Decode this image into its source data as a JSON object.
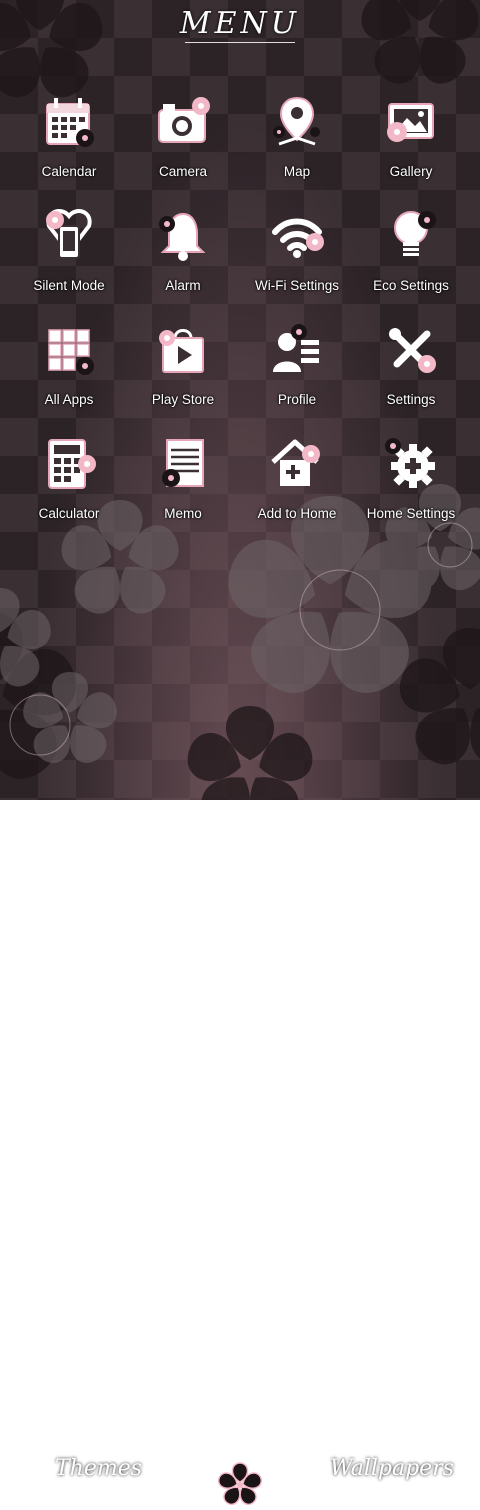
{
  "header": {
    "title": "MENU"
  },
  "apps": [
    {
      "label": "Calendar",
      "icon": "calendar-icon"
    },
    {
      "label": "Camera",
      "icon": "camera-icon"
    },
    {
      "label": "Map",
      "icon": "map-pin-icon"
    },
    {
      "label": "Gallery",
      "icon": "gallery-icon"
    },
    {
      "label": "Silent Mode",
      "icon": "silent-phone-icon"
    },
    {
      "label": "Alarm",
      "icon": "alarm-bell-icon"
    },
    {
      "label": "Wi-Fi Settings",
      "icon": "wifi-icon"
    },
    {
      "label": "Eco Settings",
      "icon": "lightbulb-icon"
    },
    {
      "label": "All Apps",
      "icon": "apps-grid-icon"
    },
    {
      "label": "Play Store",
      "icon": "play-store-icon"
    },
    {
      "label": "Profile",
      "icon": "profile-icon"
    },
    {
      "label": "Settings",
      "icon": "tools-icon"
    },
    {
      "label": "Calculator",
      "icon": "calculator-icon"
    },
    {
      "label": "Memo",
      "icon": "memo-icon"
    },
    {
      "label": "Add to Home",
      "icon": "add-home-icon"
    },
    {
      "label": "Home Settings",
      "icon": "gear-plus-icon"
    }
  ],
  "footer": {
    "themes_label": "Themes",
    "wallpapers_label": "Wallpapers"
  },
  "colors": {
    "accent_pink": "#f3b8c8",
    "background": "#2e2428"
  }
}
